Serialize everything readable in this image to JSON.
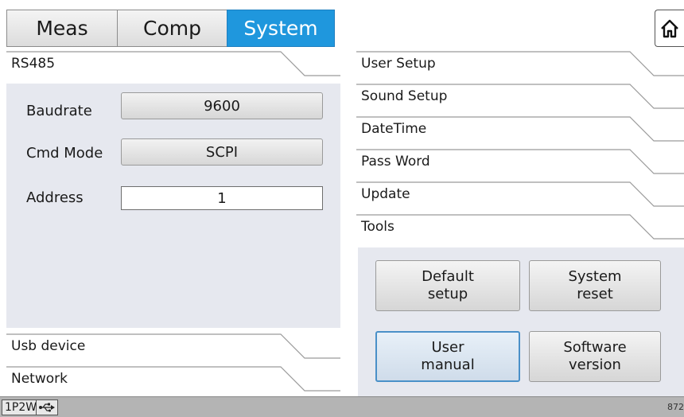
{
  "tabs": [
    {
      "label": "Meas",
      "active": false
    },
    {
      "label": "Comp",
      "active": false
    },
    {
      "label": "System",
      "active": true
    }
  ],
  "home_icon": "home-icon",
  "left_sections": {
    "rs485": "RS485",
    "usb_device": "Usb device",
    "network": "Network"
  },
  "rs485_fields": {
    "baudrate_label": "Baudrate",
    "baudrate_value": "9600",
    "cmd_mode_label": "Cmd Mode",
    "cmd_mode_value": "SCPI",
    "address_label": "Address",
    "address_value": "1"
  },
  "right_sections": [
    "User Setup",
    "Sound Setup",
    "DateTime",
    "Pass Word",
    "Update",
    "Tools"
  ],
  "tools": {
    "default_setup": "Default\nsetup",
    "system_reset": "System\nreset",
    "user_manual": "User\nmanual",
    "software_version": "Software\nversion"
  },
  "status": {
    "mode": "1P2W",
    "usb_icon": "usb-icon",
    "version_fragment": "872"
  },
  "colors": {
    "active_tab": "#1f97dd",
    "panel_bg": "#e6e8ef",
    "status_bar": "#b4b4b4"
  }
}
